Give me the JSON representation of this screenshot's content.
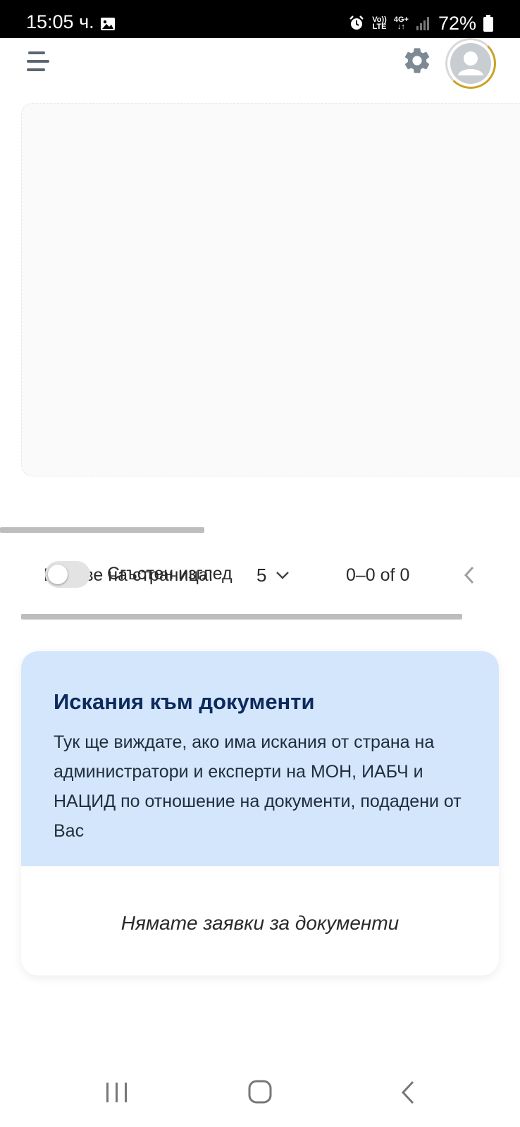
{
  "status_bar": {
    "time": "15:05 ч.",
    "volte_top": "Vo))",
    "volte_bottom": "LTE",
    "network_top": "4G+",
    "network_bottom": "↓↑",
    "battery": "72%",
    "icons": [
      "gallery-icon",
      "alarm-icon",
      "signal-icon",
      "battery-icon"
    ]
  },
  "app_bar": {
    "icons": [
      "menu-icon",
      "gear-icon",
      "avatar-user-icon"
    ]
  },
  "table_footer": {
    "rows_per_page_label": "Редове на страница:",
    "compact_view_label": "Сгъстен изглед",
    "rows_per_page_value": "5",
    "range_text": "0–0 of 0",
    "compact_toggle_on": false
  },
  "requests_card": {
    "title": "Искания към документи",
    "description": "Тук ще виждате, ако има искания от страна на администратори и експерти на МОН, ИАБЧ и НАЦИД по отношение на документи, подадени от Вас",
    "empty_text": "Нямате заявки за документи"
  },
  "colors": {
    "card_header_bg": "#d3e6fb",
    "card_title": "#0d2a5c",
    "avatar_ring_accent": "#c9a227"
  }
}
